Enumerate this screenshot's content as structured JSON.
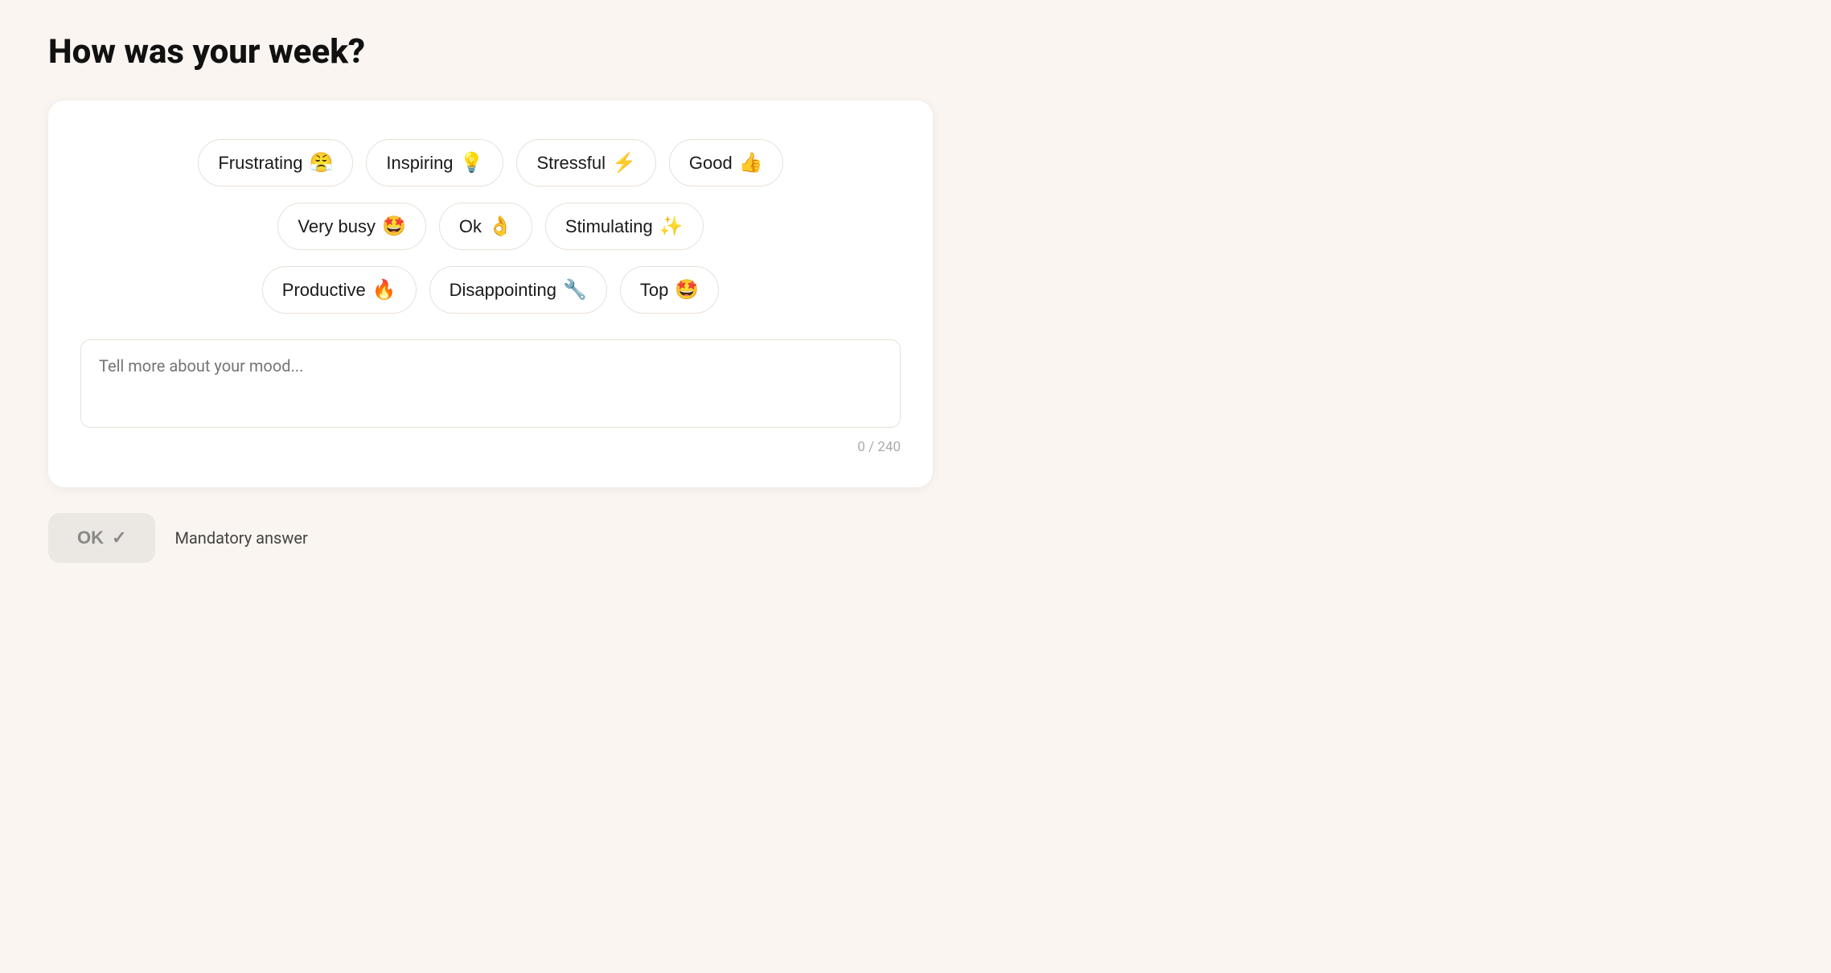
{
  "page": {
    "title": "How was your week?"
  },
  "mood_options": {
    "row1": [
      {
        "id": "frustrating",
        "label": "Frustrating",
        "emoji": "😤"
      },
      {
        "id": "inspiring",
        "label": "Inspiring",
        "emoji": "💡"
      },
      {
        "id": "stressful",
        "label": "Stressful",
        "emoji": "⚡"
      },
      {
        "id": "good",
        "label": "Good",
        "emoji": "👍"
      }
    ],
    "row2": [
      {
        "id": "very-busy",
        "label": "Very busy",
        "emoji": "🤩"
      },
      {
        "id": "ok",
        "label": "Ok",
        "emoji": "👌"
      },
      {
        "id": "stimulating",
        "label": "Stimulating",
        "emoji": "✨"
      }
    ],
    "row3": [
      {
        "id": "productive",
        "label": "Productive",
        "emoji": "🔥"
      },
      {
        "id": "disappointing",
        "label": "Disappointing",
        "emoji": "🔧"
      },
      {
        "id": "top",
        "label": "Top",
        "emoji": "🤩"
      }
    ]
  },
  "textarea": {
    "placeholder": "Tell more about your mood..."
  },
  "char_count": "0 / 240",
  "footer": {
    "ok_label": "OK",
    "ok_check": "✓",
    "mandatory_label": "Mandatory answer"
  }
}
